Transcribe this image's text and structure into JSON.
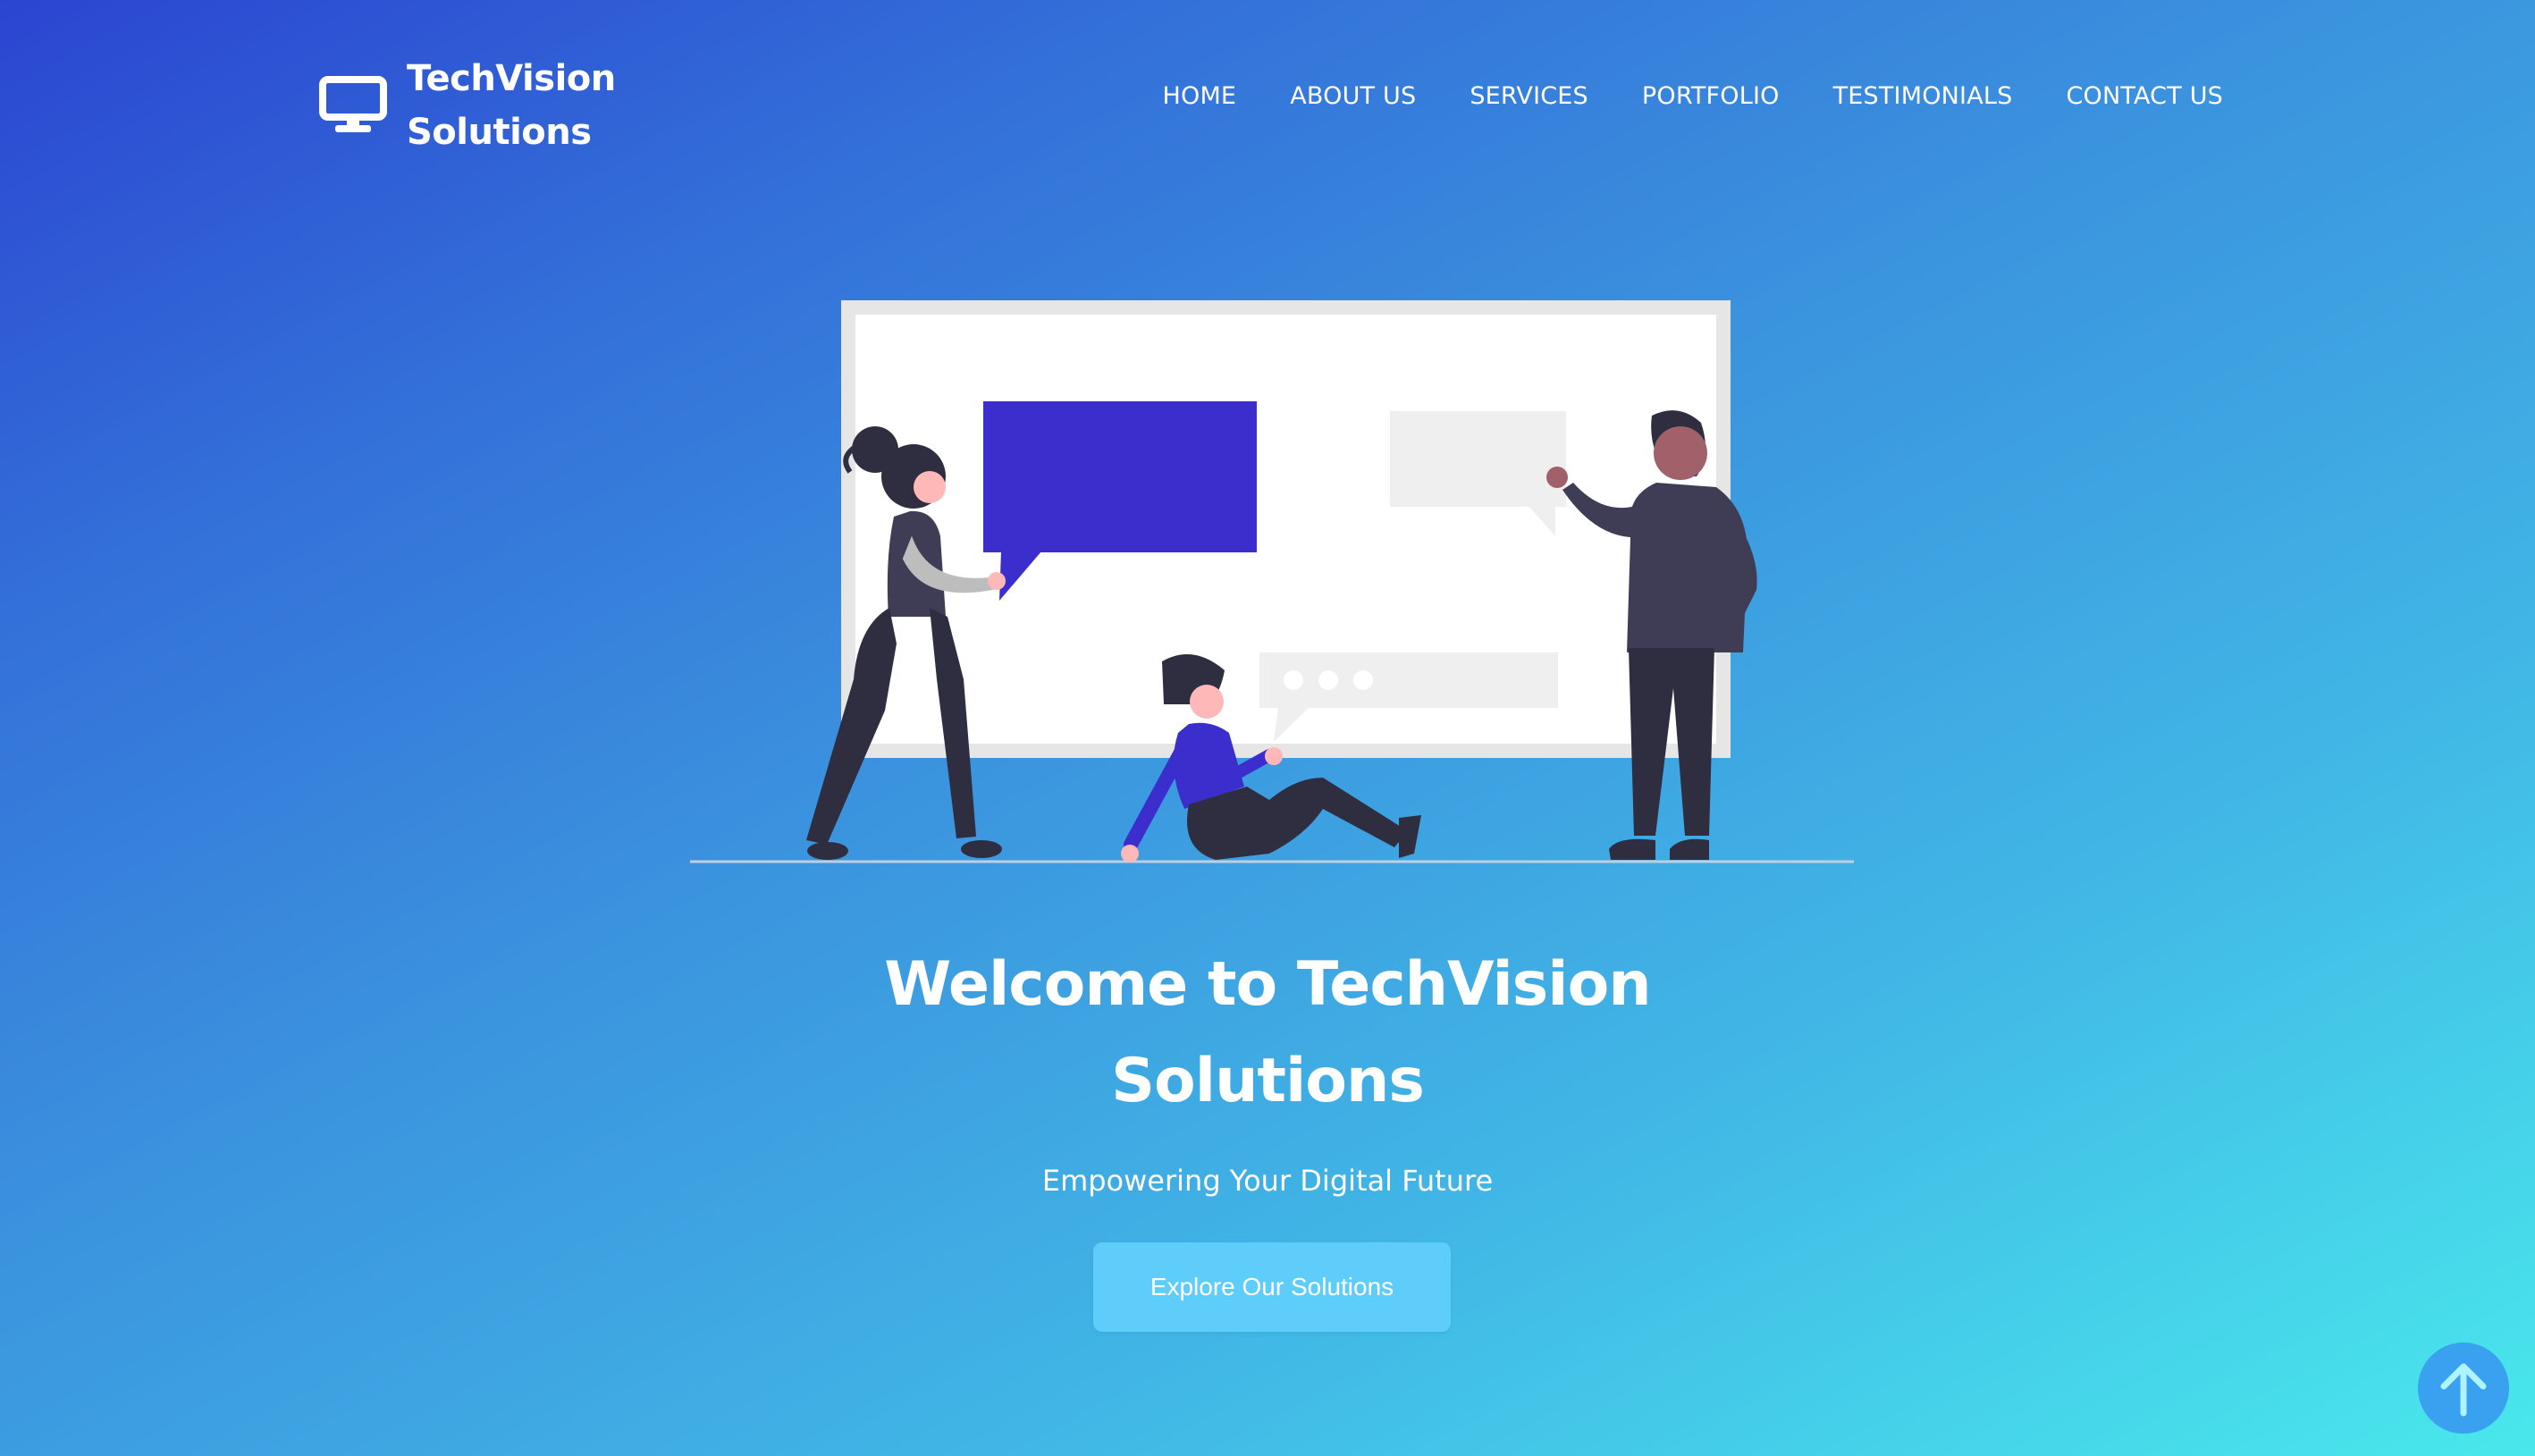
{
  "brand": {
    "name_line1": "TechVision",
    "name_line2": "Solutions",
    "icon": "desktop-monitor-icon"
  },
  "nav": {
    "items": [
      {
        "label": "HOME"
      },
      {
        "label": "ABOUT US"
      },
      {
        "label": "SERVICES"
      },
      {
        "label": "PORTFOLIO"
      },
      {
        "label": "TESTIMONIALS"
      },
      {
        "label": "CONTACT US"
      }
    ]
  },
  "hero": {
    "title_line1": "Welcome to TechVision",
    "title_line2": "Solutions",
    "subtitle": "Empowering Your Digital Future",
    "cta_label": "Explore Our Solutions"
  },
  "scroll_top": {
    "icon": "arrow-up-icon"
  },
  "colors": {
    "gradient_start": "#2b45d1",
    "gradient_end": "#49e8ec",
    "cta_background": "#5fcdfa",
    "accent_purple": "#3c2dcd",
    "figure_dark": "#2f2e41",
    "scroll_top_background": "#3aa0f0"
  }
}
